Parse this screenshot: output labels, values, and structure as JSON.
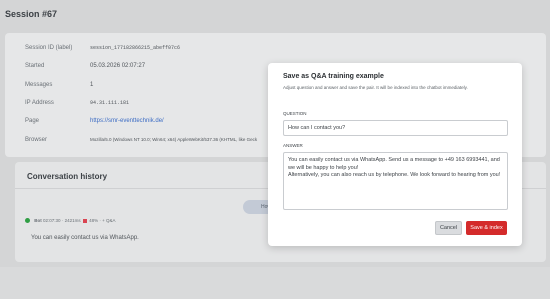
{
  "page": {
    "title": "Session #67"
  },
  "session": {
    "rows": [
      {
        "label": "Session ID (label)",
        "value": "session_177182866215_abeff07c6"
      },
      {
        "label": "Started",
        "value": "05.03.2026 02:07:27"
      },
      {
        "label": "Messages",
        "value": "1"
      },
      {
        "label": "IP Address",
        "value": "94.31.111.181"
      },
      {
        "label": "Page",
        "value": "https://smr-eventtechnik.de/"
      },
      {
        "label": "Browser",
        "value": "Mozilla/5.0 (Windows NT 10.0; Win64; x64) AppleWebKit/537.36 (KHTML, like Geck"
      }
    ]
  },
  "conversation": {
    "title": "Conversation history",
    "user_message": "How can I contact you?",
    "bot_meta": {
      "author": "Bot",
      "time": "02:07:30",
      "latency": "2421ms",
      "score": "48%",
      "action": "+ Q&A"
    },
    "bot_message": "You can easily contact us via WhatsApp."
  },
  "modal": {
    "title": "Save as Q&A training example",
    "subtitle": "Adjust question and answer and save the pair. It will be indexed into the chatbot immediately.",
    "question_label": "QUESTION",
    "question_value": "How can I contact you?",
    "answer_label": "ANSWER",
    "answer_value": "You can easily contact us via WhatsApp. Send us a message to +49 163 6993441, and we will be happy to help you!\nAlternatively, you can also reach us by telephone. We look forward to hearing from you!",
    "cancel_label": "Cancel",
    "save_label": "Save & index"
  },
  "colors": {
    "accent": "#d42b2b",
    "link": "#3c6cc4",
    "status_ok": "#2f9e44",
    "status_bad": "#d94452"
  }
}
